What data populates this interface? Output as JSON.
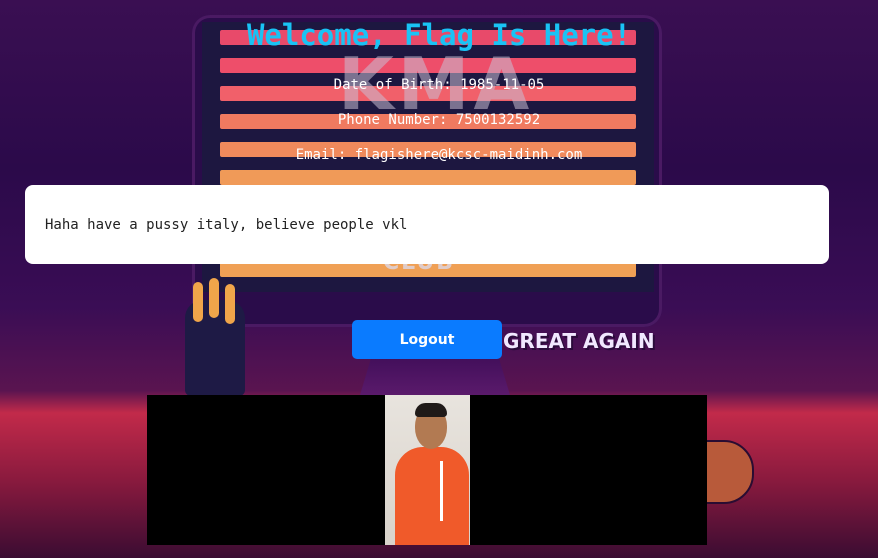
{
  "welcome_title": "Welcome, Flag Is Here!",
  "profile": {
    "dob": "Date of Birth: 1985-11-05",
    "phone": "Phone Number: 7500132592",
    "email": "Email: flagishere@kcsc-maidinh.com"
  },
  "message": "Haha have a pussy italy, believe people vkl",
  "logout_label": "Logout",
  "background_art": {
    "logo_text": "KMA",
    "sub_logo_text": "CLUB",
    "slogan": "GREAT AGAIN"
  },
  "colors": {
    "title": "#19c3f5",
    "button": "#0a7bff"
  }
}
